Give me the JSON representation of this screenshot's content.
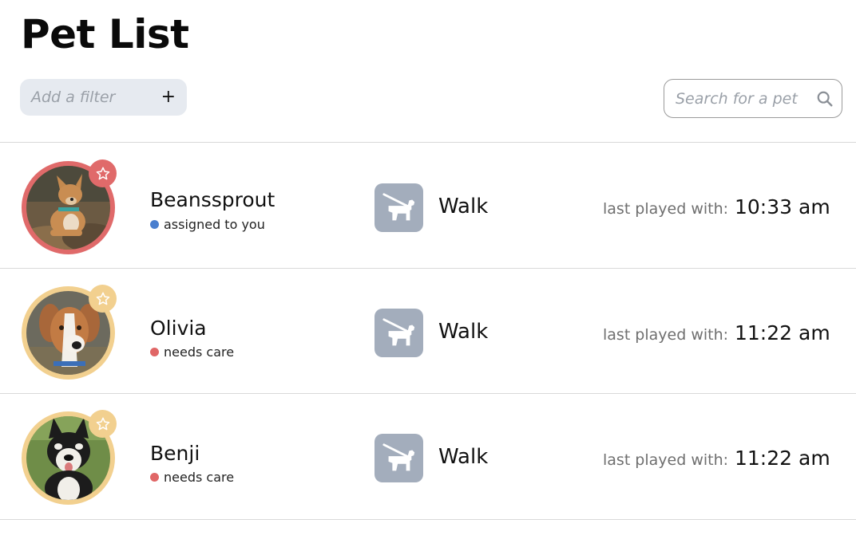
{
  "page": {
    "title": "Pet List"
  },
  "filter": {
    "placeholder": "Add a filter",
    "add_icon": "plus-icon"
  },
  "search": {
    "placeholder": "Search for a pet",
    "icon": "search-icon"
  },
  "colors": {
    "assigned": "#4a7fcf",
    "needs_care": "#e06666",
    "ring_red": "#e06a6a",
    "ring_yellow": "#f2d08f",
    "activity_tile": "#a3adbc"
  },
  "pets": [
    {
      "name": "Beanssprout",
      "status": "assigned to you",
      "status_color": "#4a7fcf",
      "ring_color": "#e06a6a",
      "activity": "Walk",
      "activity_icon": "dog-walk-icon",
      "last_played_label": "last played with:",
      "last_played_time": "10:33 am"
    },
    {
      "name": "Olivia",
      "status": "needs care",
      "status_color": "#e06666",
      "ring_color": "#f2d08f",
      "activity": "Walk",
      "activity_icon": "dog-walk-icon",
      "last_played_label": "last played with:",
      "last_played_time": "11:22 am"
    },
    {
      "name": "Benji",
      "status": "needs care",
      "status_color": "#e06666",
      "ring_color": "#f2d08f",
      "activity": "Walk",
      "activity_icon": "dog-walk-icon",
      "last_played_label": "last played with:",
      "last_played_time": "11:22 am"
    }
  ]
}
